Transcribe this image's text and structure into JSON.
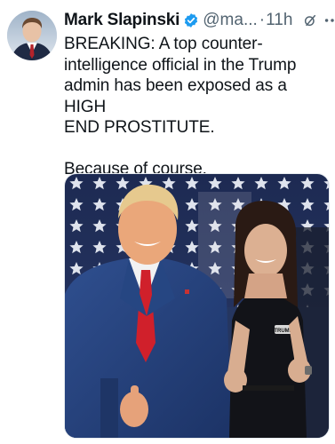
{
  "post": {
    "author_name": "Mark Slapinski",
    "handle": "@ma...",
    "separator": "·",
    "time": "11h",
    "text": "BREAKING: A top counter-\nintelligence official in the Trump\nadmin has been exposed as a HIGH\nEND PROSTITUTE.\n\nBecause of course.",
    "verified": true,
    "media": {
      "dress_pin_text": "TRUMP"
    }
  },
  "colors": {
    "verified_badge": "#1d9bf0",
    "secondary_text": "#536471"
  },
  "icons": [
    "verified-badge-icon",
    "grok-icon",
    "more-options-icon"
  ]
}
